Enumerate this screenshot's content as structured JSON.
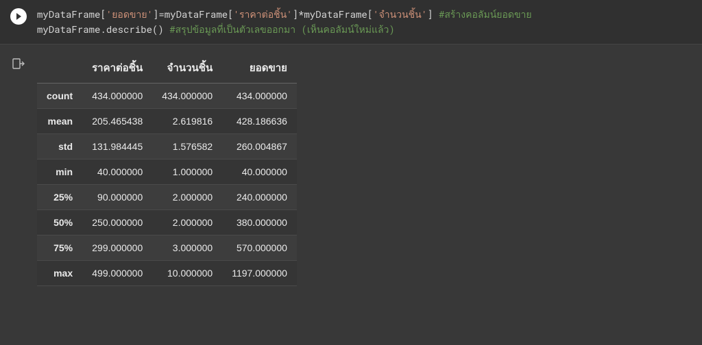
{
  "code": {
    "line1": {
      "p1": "myDataFrame[",
      "s1": "'ยอดขาย'",
      "p2": "]=myDataFrame[",
      "s2": "'ราคาต่อชิ้น'",
      "p3": "]*myDataFrame[",
      "s3": "'จำนวนชิ้น'",
      "p4": "] ",
      "c1": "#สร้างคอลัมน์ยอดขาย"
    },
    "line2": {
      "p1": "myDataFrame.describe() ",
      "c1": "#สรุปข้อมูลที่เป็นตัวเลขออกมา (เห็นคอลัมน์ใหม่แล้ว)"
    }
  },
  "chart_data": {
    "type": "table",
    "columns": [
      "ราคาต่อชิ้น",
      "จำนวนชิ้น",
      "ยอดขาย"
    ],
    "index": [
      "count",
      "mean",
      "std",
      "min",
      "25%",
      "50%",
      "75%",
      "max"
    ],
    "rows": [
      [
        "434.000000",
        "434.000000",
        "434.000000"
      ],
      [
        "205.465438",
        "2.619816",
        "428.186636"
      ],
      [
        "131.984445",
        "1.576582",
        "260.004867"
      ],
      [
        "40.000000",
        "1.000000",
        "40.000000"
      ],
      [
        "90.000000",
        "2.000000",
        "240.000000"
      ],
      [
        "250.000000",
        "2.000000",
        "380.000000"
      ],
      [
        "299.000000",
        "3.000000",
        "570.000000"
      ],
      [
        "499.000000",
        "10.000000",
        "1197.000000"
      ]
    ]
  }
}
